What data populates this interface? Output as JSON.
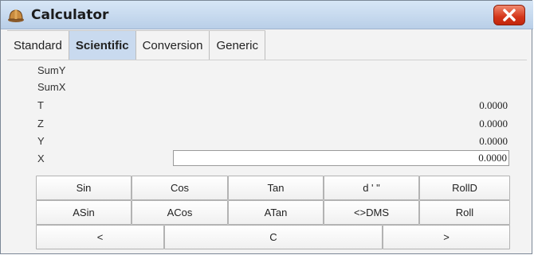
{
  "window": {
    "title": "Calculator",
    "icon": "hardhat-icon",
    "close_icon": "close-x-icon",
    "close_color": "#d4361a"
  },
  "tabs": [
    {
      "label": "Standard",
      "active": false
    },
    {
      "label": "Scientific",
      "active": true
    },
    {
      "label": "Conversion",
      "active": false
    },
    {
      "label": "Generic",
      "active": false
    }
  ],
  "registers": {
    "sumy": {
      "label": "SumY",
      "value": ""
    },
    "sumx": {
      "label": "SumX",
      "value": ""
    },
    "t": {
      "label": "T",
      "value": "0.0000"
    },
    "z": {
      "label": "Z",
      "value": "0.0000"
    },
    "y": {
      "label": "Y",
      "value": "0.0000"
    },
    "x": {
      "label": "X",
      "value": "0.0000"
    }
  },
  "buttons": {
    "row1": [
      "Sin",
      "Cos",
      "Tan",
      "d ' \"",
      "RollD"
    ],
    "row2": [
      "ASin",
      "ACos",
      "ATan",
      "<>DMS",
      "Roll"
    ],
    "row3": [
      "<",
      "C",
      ">"
    ]
  }
}
